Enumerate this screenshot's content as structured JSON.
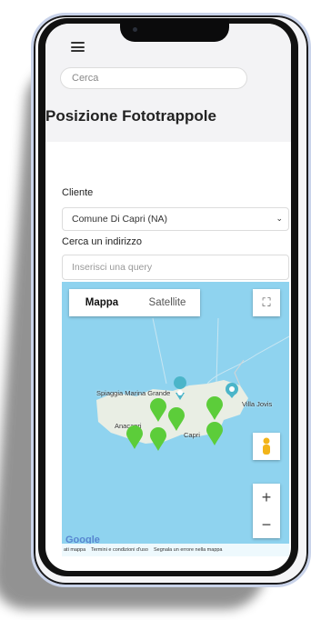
{
  "topbar": {
    "search_placeholder": "Cerca"
  },
  "page": {
    "title": "Posizione Fototrappole"
  },
  "form": {
    "client_label": "Cliente",
    "client_value": "Comune Di Capri (NA)",
    "address_label": "Cerca un indirizzo",
    "address_placeholder": "Inserisci una query"
  },
  "map": {
    "tabs": [
      {
        "label": "Mappa",
        "active": true
      },
      {
        "label": "Satellite",
        "active": false
      }
    ],
    "place_labels": {
      "beach": "Spiaggia Marina Grande",
      "villa": "Villa Jovis",
      "anacapri": "Anacapri",
      "capri": "Capri"
    },
    "zoom_in": "+",
    "zoom_out": "−",
    "footer": {
      "data": "ati mappa",
      "terms": "Termini e condizioni d'uso",
      "report": "Segnala un errore nella mappa"
    },
    "logo": "Google",
    "marker_color": "#5ccd3a",
    "poi_color": "#4bb5c9"
  }
}
